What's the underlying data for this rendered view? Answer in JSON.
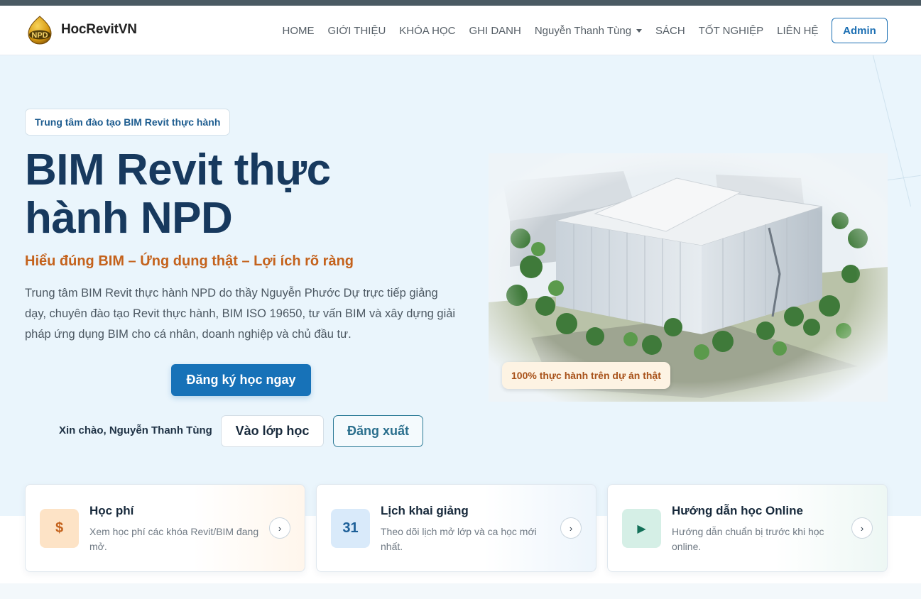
{
  "brand": {
    "logo_text": "NPD",
    "name": "HocRevitVN"
  },
  "nav": {
    "items": [
      "HOME",
      "GIỚI THIỆU",
      "KHÓA HỌC",
      "GHI DANH",
      "Nguyễn Thanh Tùng",
      "SÁCH",
      "TỐT NGHIỆP",
      "LIÊN HỆ"
    ],
    "admin_label": "Admin"
  },
  "hero": {
    "pill": "Trung tâm đào tạo BIM Revit thực hành",
    "title_line1": "BIM Revit thực",
    "title_line2": "hành NPD",
    "tagline": "Hiểu đúng BIM – Ứng dụng thật – Lợi ích rõ ràng",
    "description": "Trung tâm BIM Revit thực hành NPD do thầy Nguyễn Phước Dự trực tiếp giảng dạy, chuyên đào tạo Revit thực hành, BIM ISO 19650, tư vấn BIM và xây dựng giải pháp ứng dụng BIM cho cá nhân, doanh nghiệp và chủ đầu tư.",
    "cta_label": "Đăng ký học ngay",
    "greeting": "Xin chào, Nguyễn Thanh Tùng",
    "class_button": "Vào lớp học",
    "logout_button": "Đăng xuất",
    "image_badge": "100% thực hành trên dự án thật"
  },
  "cards": [
    {
      "icon": "$",
      "icon_name": "dollar-icon",
      "title": "Học phí",
      "desc": "Xem học phí các khóa Revit/BIM đang mở.",
      "arrow": "›"
    },
    {
      "icon": "31",
      "icon_name": "calendar-icon",
      "title": "Lịch khai giảng",
      "desc": "Theo dõi lịch mở lớp và ca học mới nhất.",
      "arrow": "›"
    },
    {
      "icon": "▶",
      "icon_name": "play-icon",
      "title": "Hướng dẫn học Online",
      "desc": "Hướng dẫn chuẩn bị trước khi học online.",
      "arrow": "›"
    }
  ],
  "colors": {
    "primary": "#1772b8",
    "title": "#17395e",
    "accent": "#c4621c",
    "hero_bg": "#eaf5fc"
  }
}
